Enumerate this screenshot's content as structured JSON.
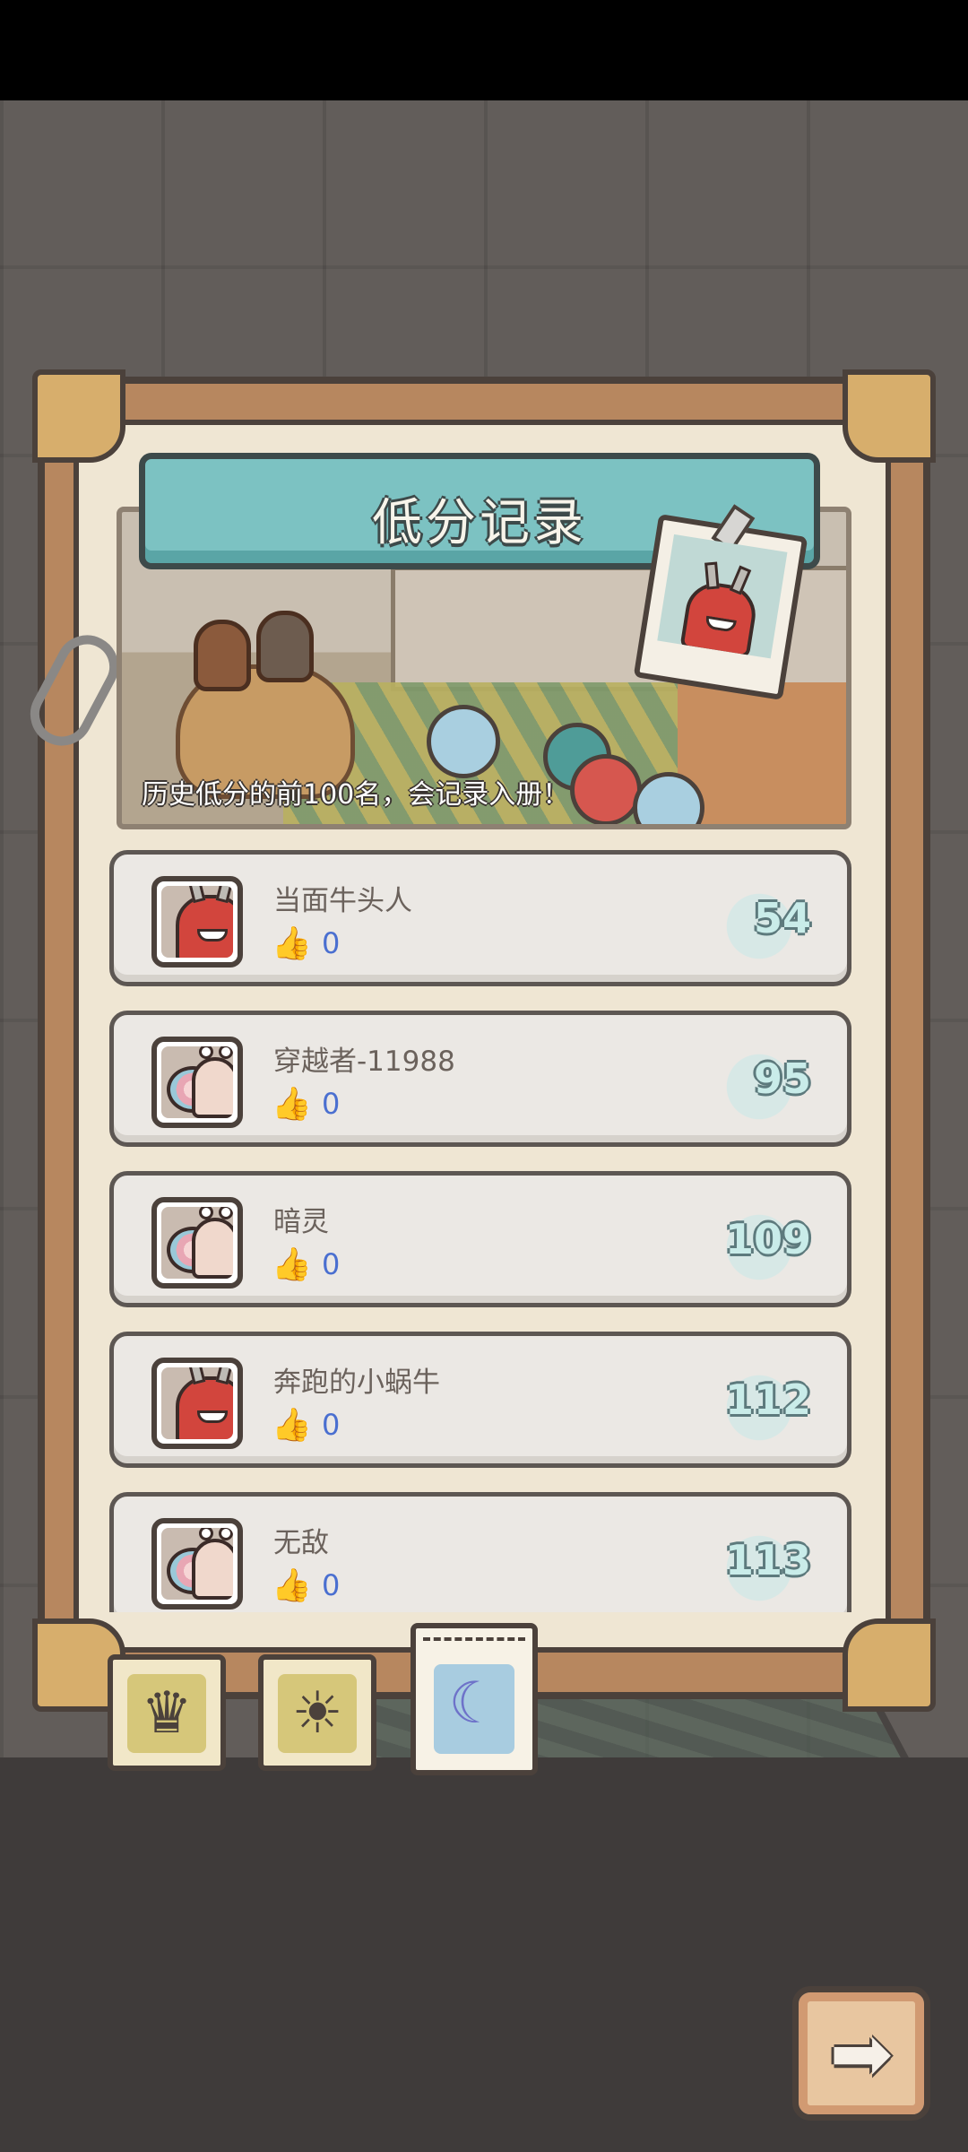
{
  "title": "低分记录",
  "banner_caption": "历史低分的前100名，会记录入册！",
  "records": [
    {
      "name": "当面牛头人",
      "likes": "0",
      "score": "54",
      "avatar": "red-horned-monster"
    },
    {
      "name": "穿越者-11988",
      "likes": "0",
      "score": "95",
      "avatar": "snail"
    },
    {
      "name": "暗灵",
      "likes": "0",
      "score": "109",
      "avatar": "snail"
    },
    {
      "name": "奔跑的小蜗牛",
      "likes": "0",
      "score": "112",
      "avatar": "red-horned-monster"
    },
    {
      "name": "无敌",
      "likes": "0",
      "score": "113",
      "avatar": "snail"
    }
  ],
  "tabs": [
    {
      "icon": "crown-icon",
      "glyph": "♛"
    },
    {
      "icon": "sun-icon",
      "glyph": "☀"
    },
    {
      "icon": "moon-icon",
      "glyph": "☾",
      "active": true
    }
  ],
  "next_button": {
    "icon": "arrow-right-icon",
    "glyph": "➡"
  },
  "colors": {
    "banner": "#7cc2c2",
    "frame": "#b7875f",
    "score_text": "#c9ece9",
    "like_count": "#4a6fd0"
  }
}
